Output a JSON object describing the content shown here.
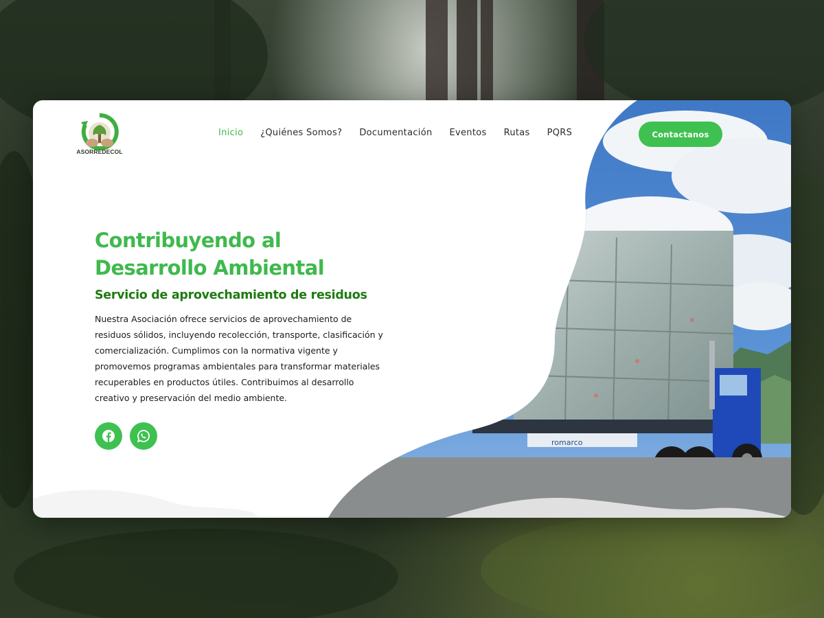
{
  "brand": {
    "name": "ASORREDECOL"
  },
  "nav": {
    "items": [
      {
        "label": "Inicio",
        "active": true
      },
      {
        "label": "¿Quiénes Somos?",
        "active": false
      },
      {
        "label": "Documentación",
        "active": false
      },
      {
        "label": "Eventos",
        "active": false
      },
      {
        "label": "Rutas",
        "active": false
      },
      {
        "label": "PQRS",
        "active": false
      }
    ],
    "cta_label": "Contactanos"
  },
  "hero": {
    "title_line1": "Contribuyendo al",
    "title_line2": "Desarrollo Ambiental",
    "subtitle": "Servicio de aprovechamiento de residuos",
    "body": "Nuestra Asociación ofrece servicios de aprovechamiento de residuos sólidos, incluyendo recolección, transporte, clasificación y comercialización. Cumplimos con la normativa vigente y promovemos programas ambientales para transformar materiales recuperables en productos útiles. Contribuimos al desarrollo creativo y preservación del medio ambiente."
  },
  "social": [
    {
      "icon": "facebook-icon"
    },
    {
      "icon": "whatsapp-icon"
    }
  ],
  "photo": {
    "truck_brand": "romarco"
  },
  "colors": {
    "accent": "#3ec150",
    "subtitle": "#1f7a12",
    "text": "#1a1a1a"
  }
}
